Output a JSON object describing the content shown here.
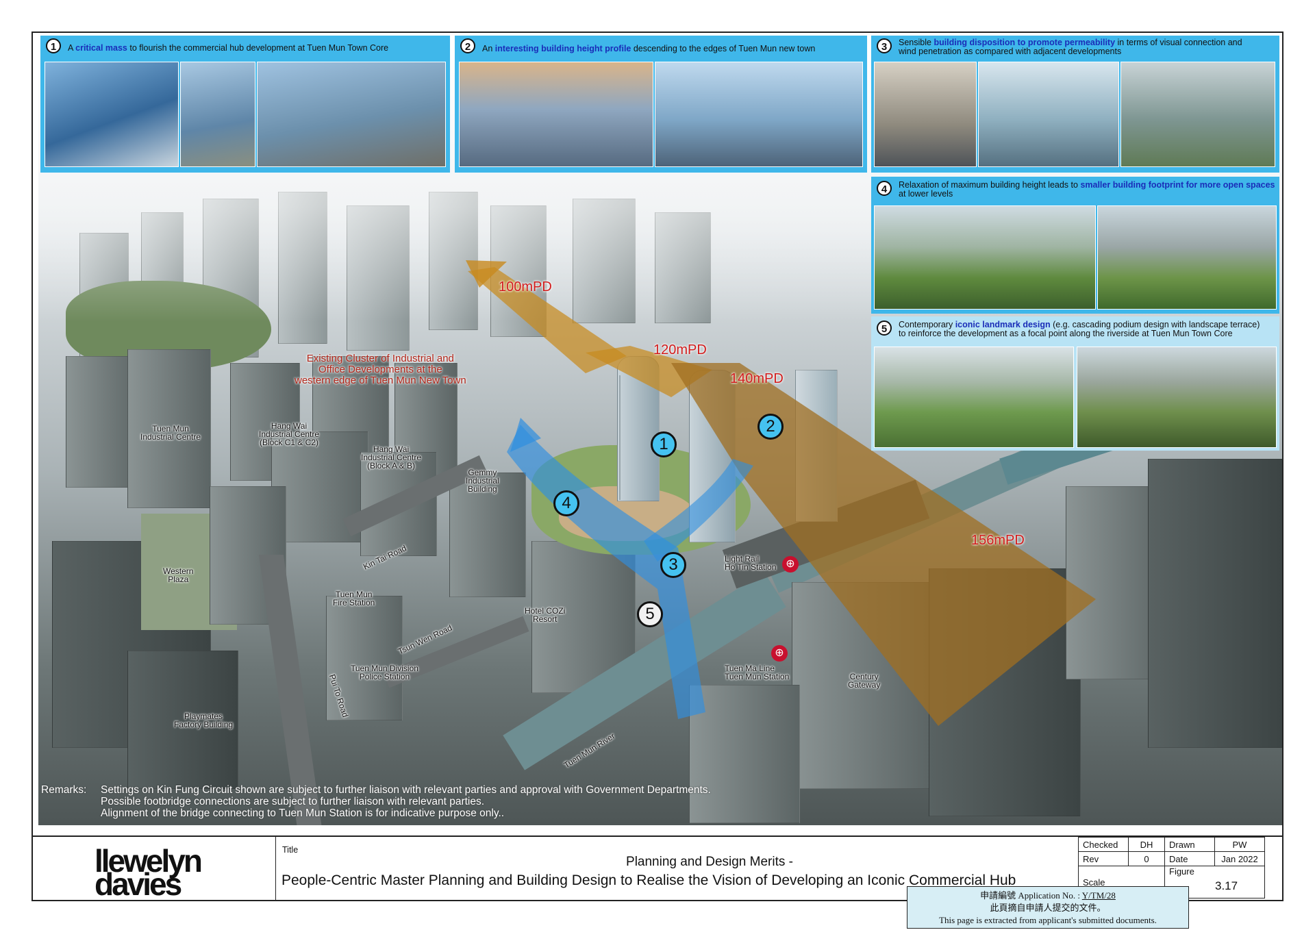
{
  "panels": {
    "p1": {
      "num": "1",
      "pre": "A ",
      "bold": "critical mass",
      "post": " to flourish the commercial hub development at Tuen Mun Town Core"
    },
    "p2": {
      "num": "2",
      "pre": "An ",
      "bold": "interesting building height profile",
      "post": " descending to the edges of Tuen Mun new town"
    },
    "p3": {
      "num": "3",
      "pre": "Sensible ",
      "bold": "building disposition to promote permeability",
      "post": " in terms of visual connection and",
      "line2": "wind penetration as compared with adjacent developments"
    },
    "p4": {
      "num": "4",
      "pre": "Relaxation of maximum building height leads to ",
      "bold": "smaller building footprint for more open spaces",
      "line2": "at lower levels"
    },
    "p5": {
      "num": "5",
      "pre": "Contemporary ",
      "bold": "iconic landmark design",
      "post": " (e.g. cascading podium design with landscape terrace)",
      "line2": "to reinforce the development as a focal point along the riverside at Tuen Mun Town Core"
    }
  },
  "heights": {
    "h100": "100mPD",
    "h120": "120mPD",
    "h140": "140mPD",
    "h156": "156mPD"
  },
  "cluster_label": [
    "Existing Cluster of Industrial and",
    "Office Developments at the",
    "western edge of Tuen Mun New Town"
  ],
  "map_labels": {
    "tuen_mun_ic": [
      "Tuen Mun",
      "Industrial Centre"
    ],
    "hang_wai_c": [
      "Hang Wai",
      "Industrial Centre",
      "(Block C1 & C2)"
    ],
    "hang_wai_ab": [
      "Hang Wai",
      "Industrial Centre",
      "(Block A & B)"
    ],
    "gemmy": [
      "Gemmy",
      "Industrial",
      "Building"
    ],
    "western_plaza": [
      "Western",
      "Plaza"
    ],
    "kin_tai_road": "Kin Tai Road",
    "fire_station": [
      "Tuen Mun",
      "Fire Station"
    ],
    "tsun_wen_road": "Tsun Wen Road",
    "hotel_cozi": [
      "Hotel COZi",
      "Resort"
    ],
    "police": [
      "Tuen Mun Division",
      "Police Station"
    ],
    "pui_to_road": "Pui To Road",
    "playmates": [
      "Playmates",
      "Factory Building"
    ],
    "light_rail": [
      "Light Rail",
      "Ho Tin Station"
    ],
    "tuen_ma_line": [
      "Tuen Ma Line",
      "Tuen Mun Station"
    ],
    "century_gateway": [
      "Century",
      "Gateway"
    ],
    "tuen_mun_river": "Tuen Mun River"
  },
  "markers": {
    "m1": "1",
    "m2": "2",
    "m3": "3",
    "m4": "4",
    "m5": "5"
  },
  "mtr_symbol": "⊕",
  "remarks": {
    "head": "Remarks:",
    "lines": [
      "Settings on Kin Fung Circuit shown are subject to further liaison with relevant parties and approval with Government Departments.",
      "Possible footbridge connections are subject to further liaison with relevant parties.",
      "Alignment of the bridge connecting to Tuen Mun Station is for indicative purpose only.."
    ]
  },
  "titleblock": {
    "logo_line1": "llewelyn",
    "logo_line2": "davies",
    "title_label": "Title",
    "title_line1": "Planning and Design Merits -",
    "title_line2": "People-Centric Master Planning and Building Design to Realise the Vision of Developing an Iconic Commercial Hub",
    "checked_label": "Checked",
    "checked_val": "DH",
    "drawn_label": "Drawn",
    "drawn_val": "PW",
    "rev_label": "Rev",
    "rev_val": "0",
    "date_label": "Date",
    "date_val": "Jan 2022",
    "scale_label": "Scale",
    "figure_label": "Figure",
    "figure_val": "3.17"
  },
  "stamp": {
    "line1_prefix": "申請編號 Application No. :",
    "app_no": "Y/TM/28",
    "line2": "此頁摘自申請人提交的文件。",
    "line3": "This page is extracted from applicant's submitted documents."
  },
  "colors": {
    "panel_blue": "#3fb7ea",
    "panel_light": "#b8e3f5",
    "highlight_text": "#1a2db8",
    "height_red": "#d21c1c",
    "envelope": "#c88a1e",
    "flow_blue": "#2f8fe0"
  }
}
